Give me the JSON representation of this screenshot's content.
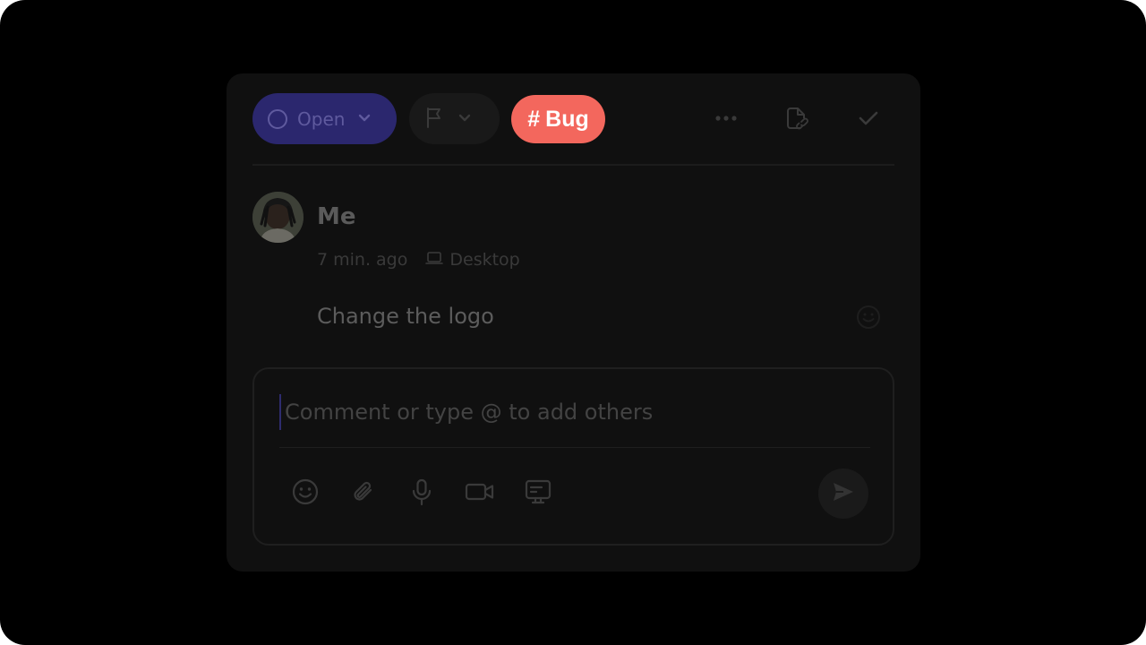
{
  "toolbar": {
    "status_label": "Open",
    "tag_symbol": "#",
    "tag_label": "Bug",
    "icons": [
      "circle-icon",
      "chevron-down-icon",
      "flag-icon",
      "more-icon",
      "file-link-icon",
      "check-icon"
    ]
  },
  "comment": {
    "author": "Me",
    "time": "7 min. ago",
    "device": "Desktop",
    "body": "Change the logo"
  },
  "composer": {
    "placeholder": "Comment or type @ to add others",
    "actions": [
      "emoji-icon",
      "attachment-icon",
      "microphone-icon",
      "video-icon",
      "screen-icon",
      "send-icon"
    ]
  },
  "colors": {
    "status_bg": "#2b276e",
    "tag_bg": "#f3675d",
    "card_bg": "#101010"
  }
}
